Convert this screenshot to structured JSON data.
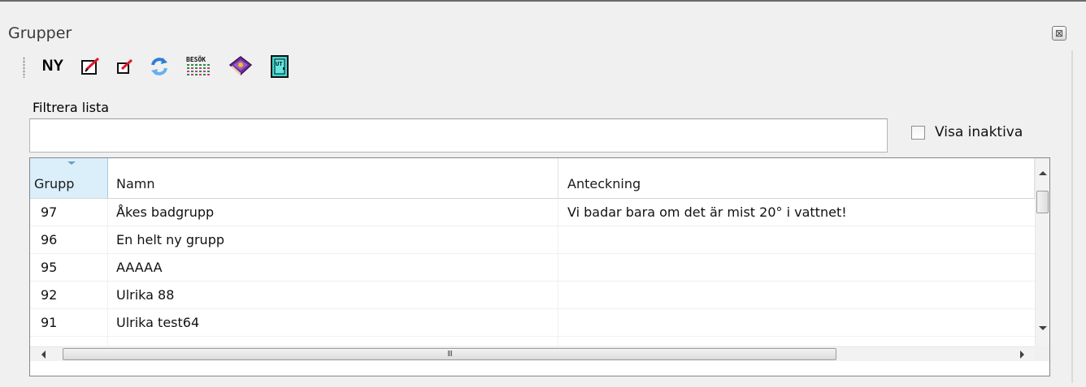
{
  "panel": {
    "title": "Grupper",
    "close_glyph": "⊠"
  },
  "toolbar": {
    "new_label": "NY",
    "icons": [
      "edit-icon",
      "small-edit-icon",
      "refresh-icon",
      "visits-icon",
      "book-icon",
      "exit-door-icon"
    ],
    "visits_text": "BESÖK",
    "exit_text": "UT"
  },
  "filter": {
    "label": "Filtrera lista",
    "value": ""
  },
  "show_inactive": {
    "label": "Visa inaktiva",
    "checked": false
  },
  "grid": {
    "columns": [
      "Grupp",
      "Namn",
      "Anteckning"
    ],
    "sorted_column": "Grupp",
    "rows": [
      {
        "grupp": "97",
        "namn": "Åkes badgrupp",
        "anteckning": "Vi badar bara om det är mist 20° i vattnet!"
      },
      {
        "grupp": "96",
        "namn": "En helt ny grupp",
        "anteckning": ""
      },
      {
        "grupp": "95",
        "namn": "AAAAA",
        "anteckning": ""
      },
      {
        "grupp": "92",
        "namn": "Ulrika 88",
        "anteckning": ""
      },
      {
        "grupp": "91",
        "namn": "Ulrika test64",
        "anteckning": ""
      },
      {
        "grupp": "",
        "namn": "",
        "anteckning": ""
      }
    ],
    "hscroll_grip": "III"
  },
  "colors": {
    "panel_bg": "#f0f0f0",
    "sorted_header_bg": "#dbeffb",
    "grid_border": "#828790"
  }
}
